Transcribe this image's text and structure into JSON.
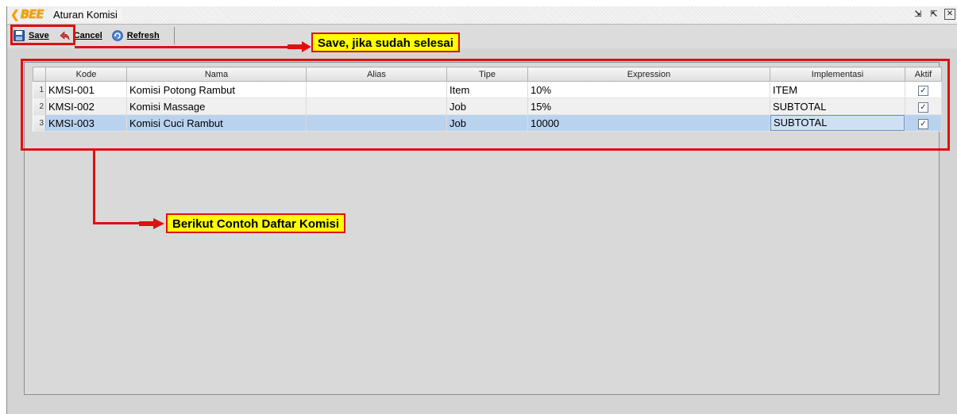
{
  "window": {
    "logo_text": "BEE",
    "title": "Aturan Komisi",
    "controls": [
      "restore",
      "maximize",
      "close"
    ]
  },
  "toolbar": {
    "save_label": "Save",
    "cancel_label": "Cancel",
    "refresh_label": "Refresh"
  },
  "table": {
    "columns": [
      "Kode",
      "Nama",
      "Alias",
      "Tipe",
      "Expression",
      "Implementasi",
      "Aktif"
    ],
    "rows": [
      {
        "no": "1",
        "kode": "KMSI-001",
        "nama": "Komisi Potong Rambut",
        "alias": "",
        "tipe": "Item",
        "expression": "10%",
        "implementasi": "ITEM",
        "aktif": true
      },
      {
        "no": "2",
        "kode": "KMSI-002",
        "nama": "Komisi Massage",
        "alias": "",
        "tipe": "Job",
        "expression": "15%",
        "implementasi": "SUBTOTAL",
        "aktif": true
      },
      {
        "no": "3",
        "kode": "KMSI-003",
        "nama": "Komisi Cuci Rambut",
        "alias": "",
        "tipe": "Job",
        "expression": "10000",
        "implementasi": "SUBTOTAL",
        "aktif": true
      }
    ],
    "selected_row": 3
  },
  "annotations": {
    "save_note": "Save, jika sudah selesai",
    "list_note": "Berikut Contoh Daftar Komisi",
    "highlight_color": "#e01010",
    "note_bg": "#ffff00"
  }
}
